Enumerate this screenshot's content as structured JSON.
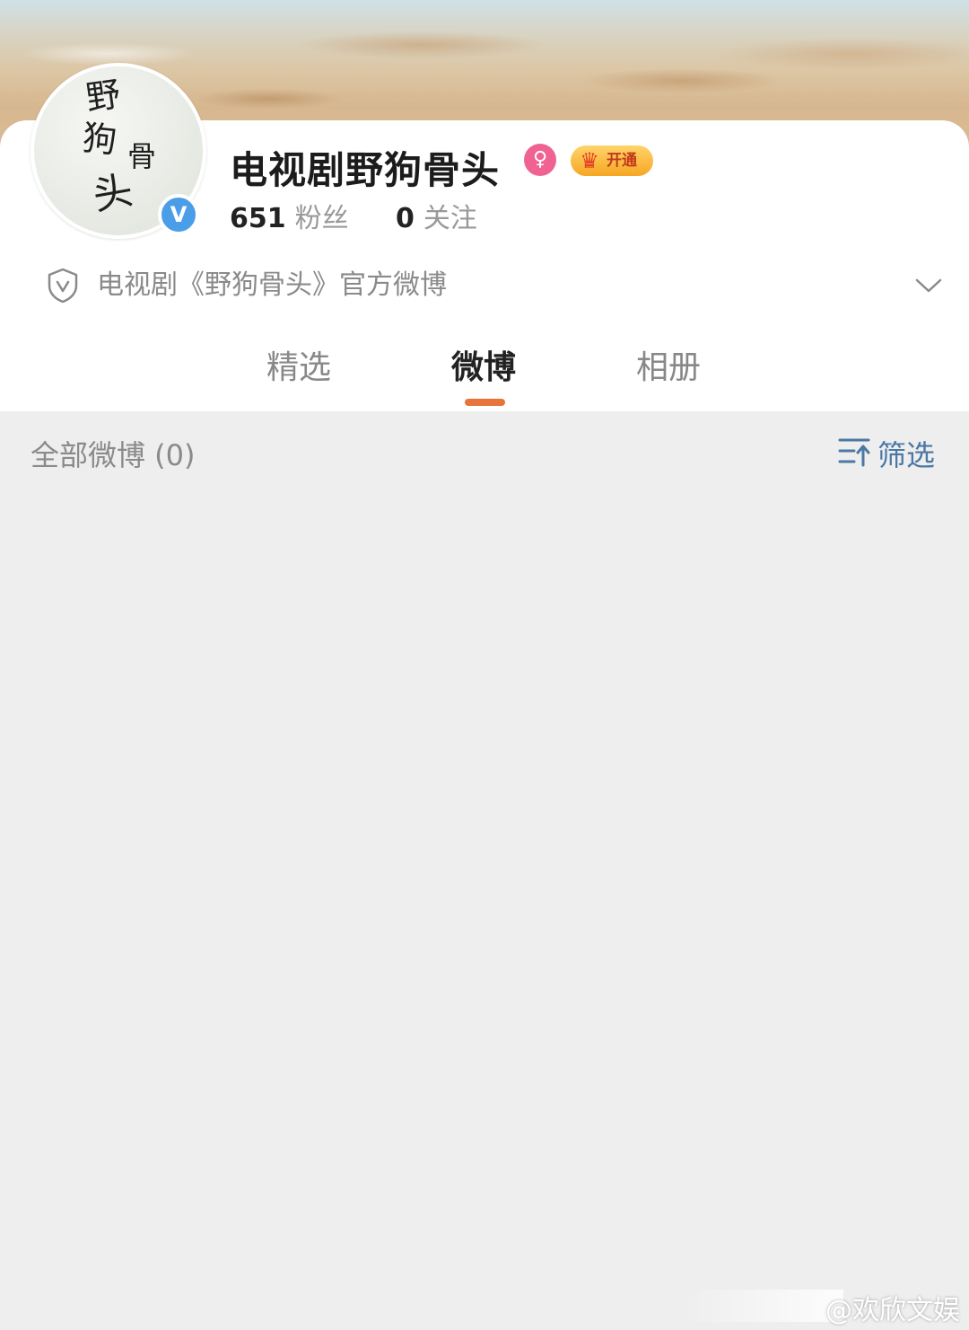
{
  "profile": {
    "name": "电视剧野狗骨头",
    "avatar_text": [
      "野",
      "狗",
      "骨",
      "头"
    ],
    "vip_label": "开通",
    "fans_count": "651",
    "fans_label": "粉丝",
    "following_count": "0",
    "following_label": "关注",
    "bio": "电视剧《野狗骨头》官方微博"
  },
  "tabs": [
    {
      "label": "精选",
      "active": false
    },
    {
      "label": "微博",
      "active": true
    },
    {
      "label": "相册",
      "active": false
    }
  ],
  "feed": {
    "title": "全部微博 (0)",
    "filter_label": "筛选"
  },
  "watermark": "@欢欣文娱",
  "colors": {
    "accent": "#e8743b",
    "verified": "#4a9ee8",
    "gender": "#f06292",
    "link": "#4b78a4",
    "background": "#eeeeee"
  },
  "icons": {
    "verified": "verified-badge-icon",
    "gender": "female-icon",
    "vip": "crown-icon",
    "bio": "shield-icon",
    "expand": "chevron-down-icon",
    "filter": "filter-sort-icon"
  }
}
